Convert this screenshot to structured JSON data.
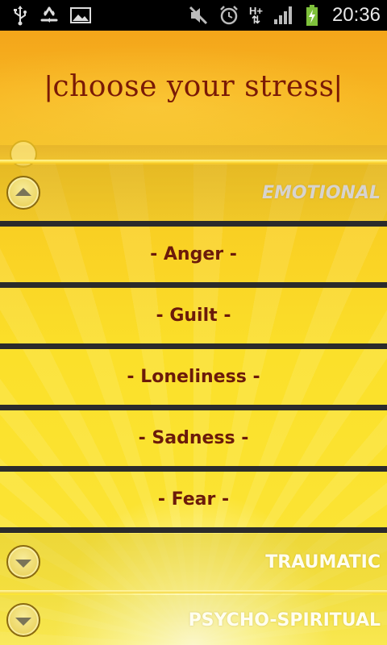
{
  "status_bar": {
    "time": "20:36",
    "network": "H+",
    "icons": [
      "usb-icon",
      "recycle-icon",
      "gallery-icon",
      "mute-icon",
      "alarm-icon",
      "network-type-icon",
      "signal-icon",
      "battery-charging-icon"
    ]
  },
  "header": {
    "title": "choose your stress",
    "title_bar": "|"
  },
  "categories": [
    {
      "label": "EMOTIONAL",
      "expanded": true,
      "items": [
        "- Anger -",
        "- Guilt -",
        "- Loneliness -",
        "- Sadness -",
        "- Fear -"
      ]
    },
    {
      "label": "TRAUMATIC",
      "expanded": false
    },
    {
      "label": "PSYCHO-SPIRITUAL",
      "expanded": false
    }
  ],
  "colors": {
    "status_bar": "#000000",
    "title": "#7a1a06",
    "item_text": "#6b1a0a",
    "divider": "#2b2b2b",
    "background_top": "#f7b21c",
    "background_bottom": "#fbe63a"
  }
}
